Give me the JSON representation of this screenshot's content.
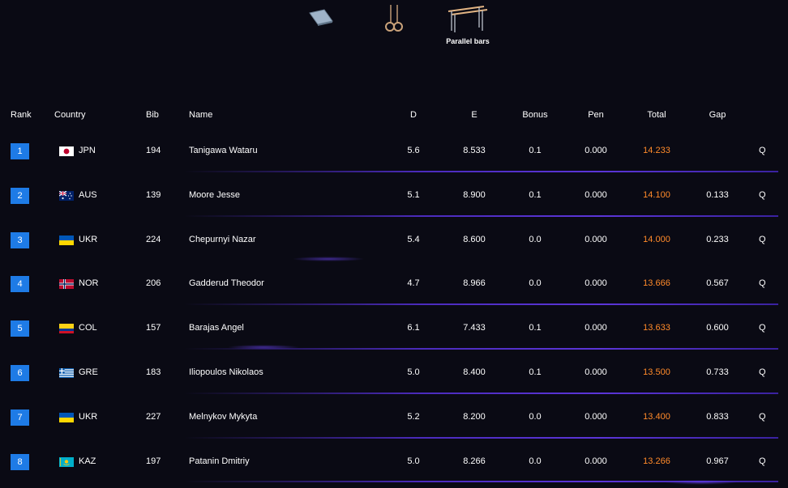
{
  "apparatus": {
    "items": [
      {
        "name": "floor",
        "label": ""
      },
      {
        "name": "rings",
        "label": ""
      },
      {
        "name": "parallel-bars",
        "label": "Parallel bars"
      }
    ]
  },
  "table": {
    "headers": {
      "rank": "Rank",
      "country": "Country",
      "bib": "Bib",
      "name": "Name",
      "d": "D",
      "e": "E",
      "bonus": "Bonus",
      "pen": "Pen",
      "total": "Total",
      "gap": "Gap"
    },
    "rows": [
      {
        "rank": "1",
        "flag": "JPN",
        "country": "JPN",
        "bib": "194",
        "name": "Tanigawa Wataru",
        "d": "5.6",
        "e": "8.533",
        "bonus": "0.1",
        "pen": "0.000",
        "total": "14.233",
        "gap": "",
        "q": "Q"
      },
      {
        "rank": "2",
        "flag": "AUS",
        "country": "AUS",
        "bib": "139",
        "name": "Moore Jesse",
        "d": "5.1",
        "e": "8.900",
        "bonus": "0.1",
        "pen": "0.000",
        "total": "14.100",
        "gap": "0.133",
        "q": "Q"
      },
      {
        "rank": "3",
        "flag": "UKR",
        "country": "UKR",
        "bib": "224",
        "name": "Chepurnyi Nazar",
        "d": "5.4",
        "e": "8.600",
        "bonus": "0.0",
        "pen": "0.000",
        "total": "14.000",
        "gap": "0.233",
        "q": "Q"
      },
      {
        "rank": "4",
        "flag": "NOR",
        "country": "NOR",
        "bib": "206",
        "name": "Gadderud Theodor",
        "d": "4.7",
        "e": "8.966",
        "bonus": "0.0",
        "pen": "0.000",
        "total": "13.666",
        "gap": "0.567",
        "q": "Q"
      },
      {
        "rank": "5",
        "flag": "COL",
        "country": "COL",
        "bib": "157",
        "name": "Barajas Angel",
        "d": "6.1",
        "e": "7.433",
        "bonus": "0.1",
        "pen": "0.000",
        "total": "13.633",
        "gap": "0.600",
        "q": "Q"
      },
      {
        "rank": "6",
        "flag": "GRE",
        "country": "GRE",
        "bib": "183",
        "name": "Iliopoulos Nikolaos",
        "d": "5.0",
        "e": "8.400",
        "bonus": "0.1",
        "pen": "0.000",
        "total": "13.500",
        "gap": "0.733",
        "q": "Q"
      },
      {
        "rank": "7",
        "flag": "UKR",
        "country": "UKR",
        "bib": "227",
        "name": "Melnykov Mykyta",
        "d": "5.2",
        "e": "8.200",
        "bonus": "0.0",
        "pen": "0.000",
        "total": "13.400",
        "gap": "0.833",
        "q": "Q"
      },
      {
        "rank": "8",
        "flag": "KAZ",
        "country": "KAZ",
        "bib": "197",
        "name": "Patanin Dmitriy",
        "d": "5.0",
        "e": "8.266",
        "bonus": "0.0",
        "pen": "0.000",
        "total": "13.266",
        "gap": "0.967",
        "q": "Q"
      }
    ]
  },
  "colors": {
    "background": "#0a0a14",
    "rank_badge": "#1e7be6",
    "total_text": "#ff8a2a",
    "divider": "#5b35d8"
  }
}
